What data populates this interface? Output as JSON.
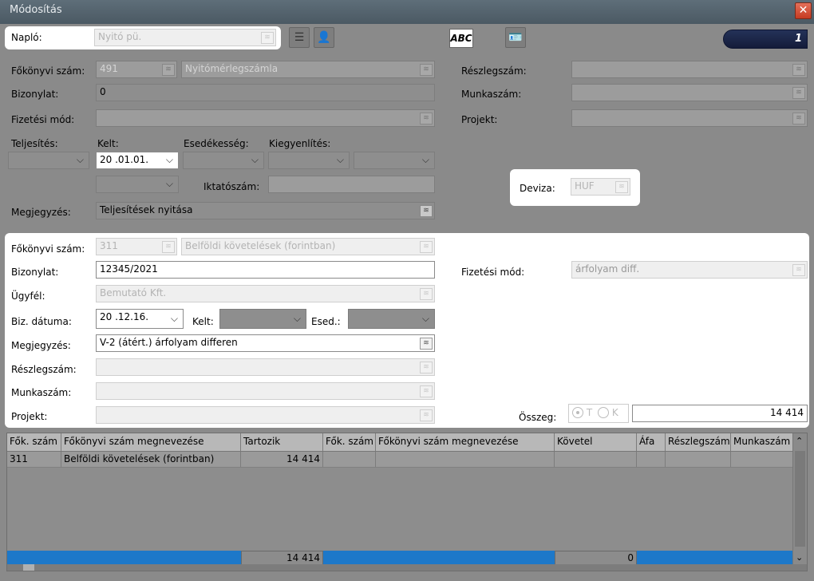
{
  "window": {
    "title": "Módosítás",
    "close_glyph": "✕"
  },
  "top": {
    "naplo_label": "Napló:",
    "naplo_value": "Nyitó pü.",
    "abc_label": "ABC",
    "counter": "1"
  },
  "head": {
    "fokonyvi_label": "Főkönyvi szám:",
    "fokonyvi_num": "491",
    "fokonyvi_name": "Nyitómérlegszámla",
    "bizonylat_label": "Bizonylat:",
    "bizonylat_value": "0",
    "fizetesi_label": "Fizetési mód:",
    "fizetesi_value": "",
    "reszleg_label": "Részlegszám:",
    "munka_label": "Munkaszám:",
    "projekt_label": "Projekt:",
    "teljesites_label": "Teljesítés:",
    "kelt_label": "Kelt:",
    "esed_label": "Esedékesség:",
    "kiegy_label": "Kiegyenlítés:",
    "kelt_value": "20 .01.01.",
    "iktato_label": "Iktatószám:",
    "deviza_label": "Deviza:",
    "deviza_value": "HUF",
    "megjegyzes_label": "Megjegyzés:",
    "megjegyzes_value": "Teljesítések nyitása"
  },
  "line": {
    "fokonyvi_label": "Főkönyvi szám:",
    "fokonyvi_num": "311",
    "fokonyvi_name": "Belföldi követelések (forintban)",
    "bizonylat_label": "Bizonylat:",
    "bizonylat_value": "12345/2021",
    "ugyfel_label": "Ügyfél:",
    "ugyfel_value": "Bemutató Kft.",
    "bizdatum_label": "Biz. dátuma:",
    "bizdatum_value": "20 .12.16.",
    "kelt_label": "Kelt:",
    "esed_label": "Esed.:",
    "megjegyzes_label": "Megjegyzés:",
    "megjegyzes_value": "V-2 (átért.) árfolyam differen",
    "reszleg_label": "Részlegszám:",
    "munka_label": "Munkaszám:",
    "projekt_label": "Projekt:",
    "fizetesi_label": "Fizetési mód:",
    "fizetesi_value": "árfolyam diff.",
    "osszeg_label": "Összeg:",
    "radio_t": "T",
    "radio_k": "K",
    "osszeg_value": "14 414"
  },
  "grid": {
    "headers": [
      "Fők. szám",
      "Főkönyvi szám megnevezése",
      "Tartozik",
      "Fők. szám",
      "Főkönyvi szám megnevezése",
      "Követel",
      "Áfa",
      "Részlegszám",
      "Munkaszám"
    ],
    "rows": [
      [
        "311",
        "Belföldi követelések (forintban)",
        "14 414",
        "",
        "",
        "",
        "",
        "",
        ""
      ]
    ],
    "total_tartozik": "14 414",
    "total_kovetel": "0"
  }
}
